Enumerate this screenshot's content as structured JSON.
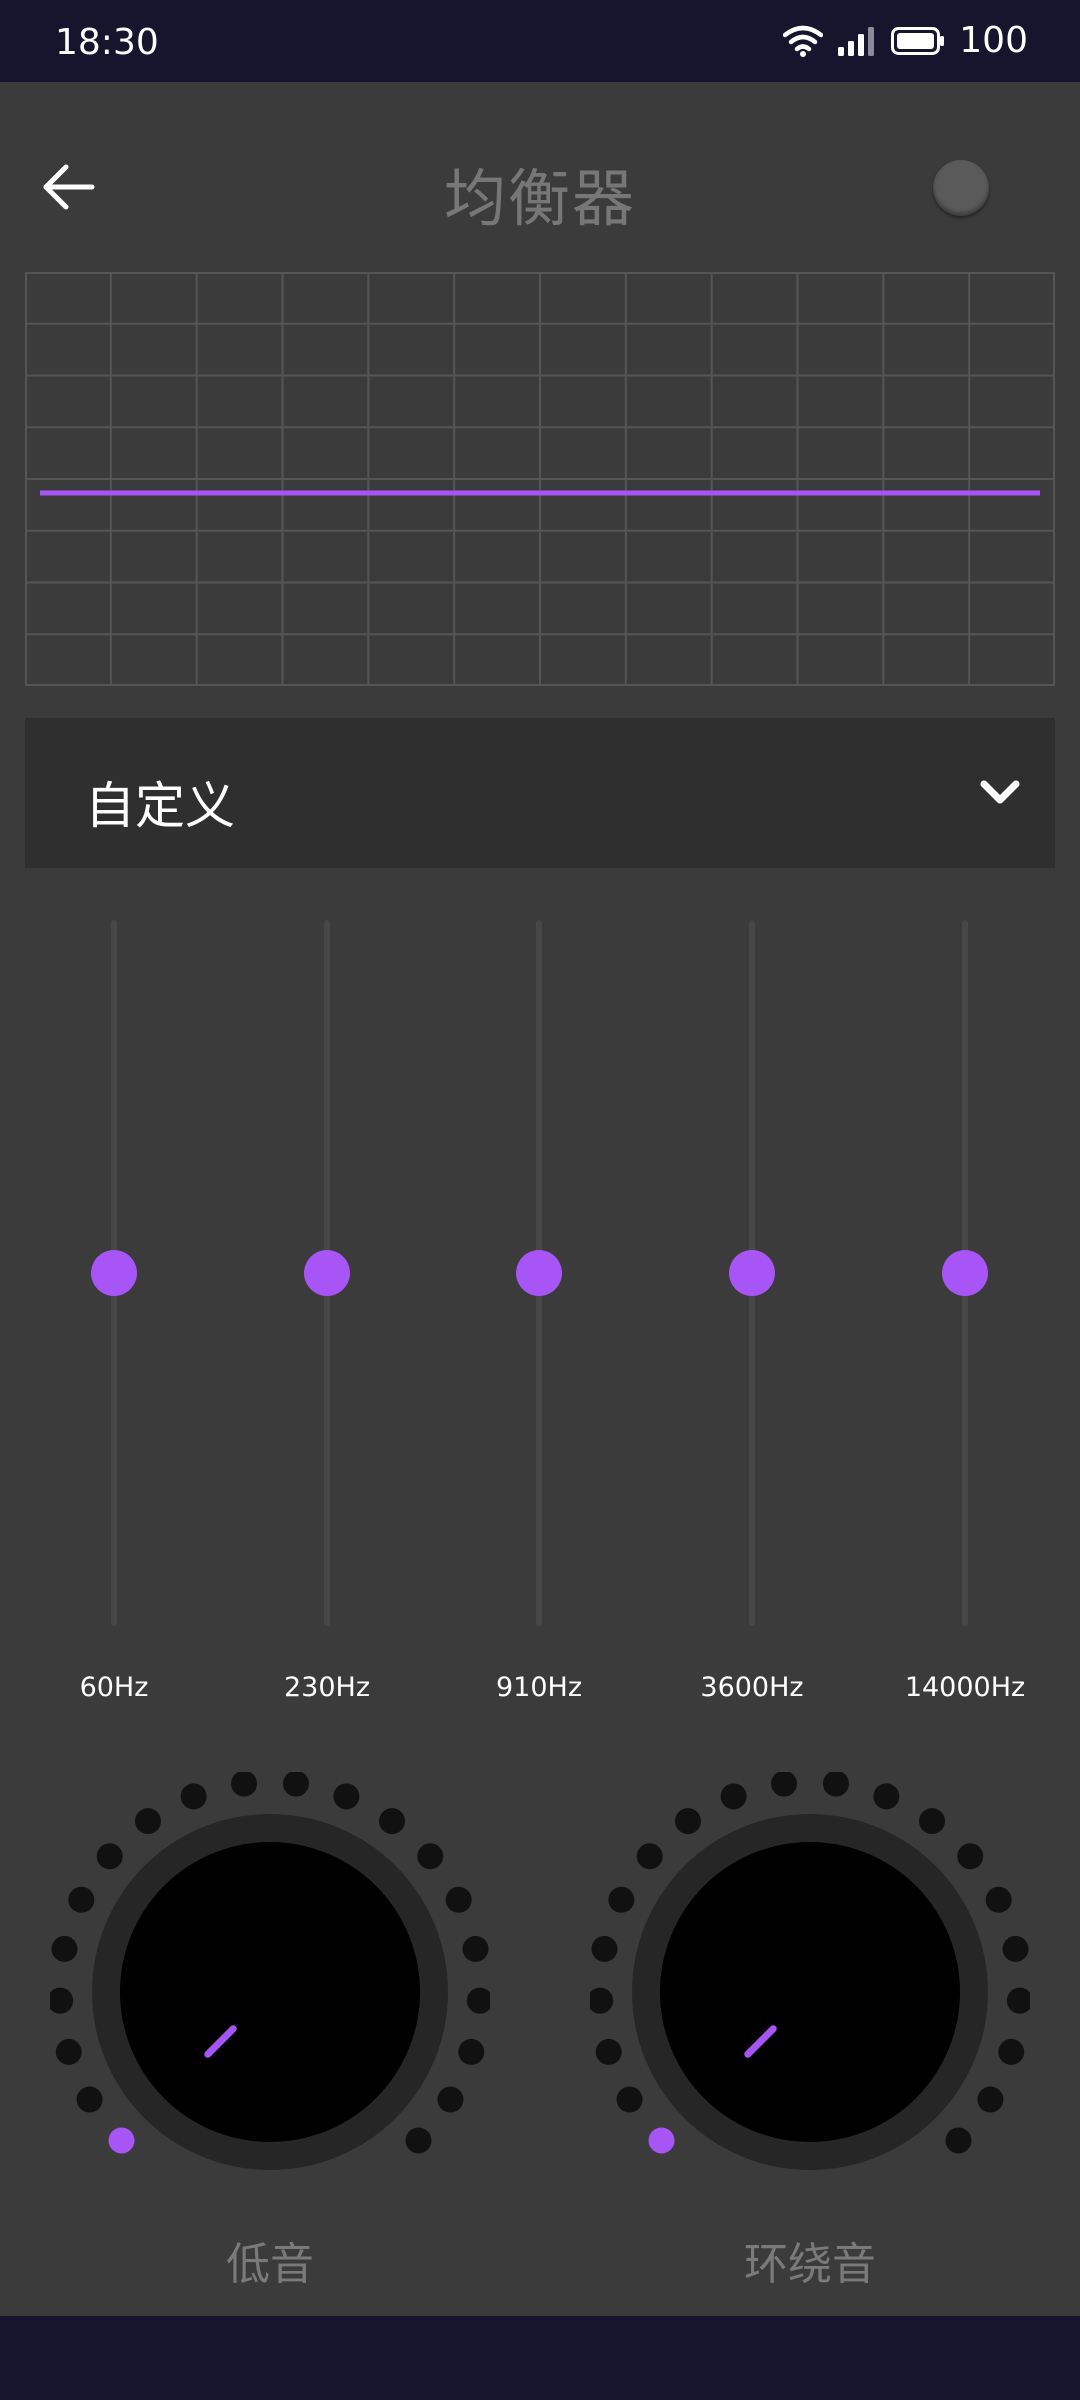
{
  "status": {
    "time": "18:30",
    "battery": "100"
  },
  "header": {
    "title": "均衡器"
  },
  "preset": {
    "selected": "自定义"
  },
  "bands": [
    {
      "label": "60Hz",
      "level": 0.5
    },
    {
      "label": "230Hz",
      "level": 0.5
    },
    {
      "label": "910Hz",
      "level": 0.5
    },
    {
      "label": "3600Hz",
      "level": 0.5
    },
    {
      "label": "14000Hz",
      "level": 0.5
    }
  ],
  "knobs": [
    {
      "label": "低音",
      "level": 0
    },
    {
      "label": "环绕音",
      "level": 0
    }
  ],
  "colors": {
    "accent": "#a855f7",
    "background": "#3b3b3b",
    "statusbar": "#17142e",
    "panel": "#2f2f2f"
  },
  "icons": {
    "back": "arrow-left-icon",
    "dropdown": "chevron-down-icon",
    "wifi": "wifi-icon",
    "signal": "signal-icon",
    "battery": "battery-icon"
  }
}
